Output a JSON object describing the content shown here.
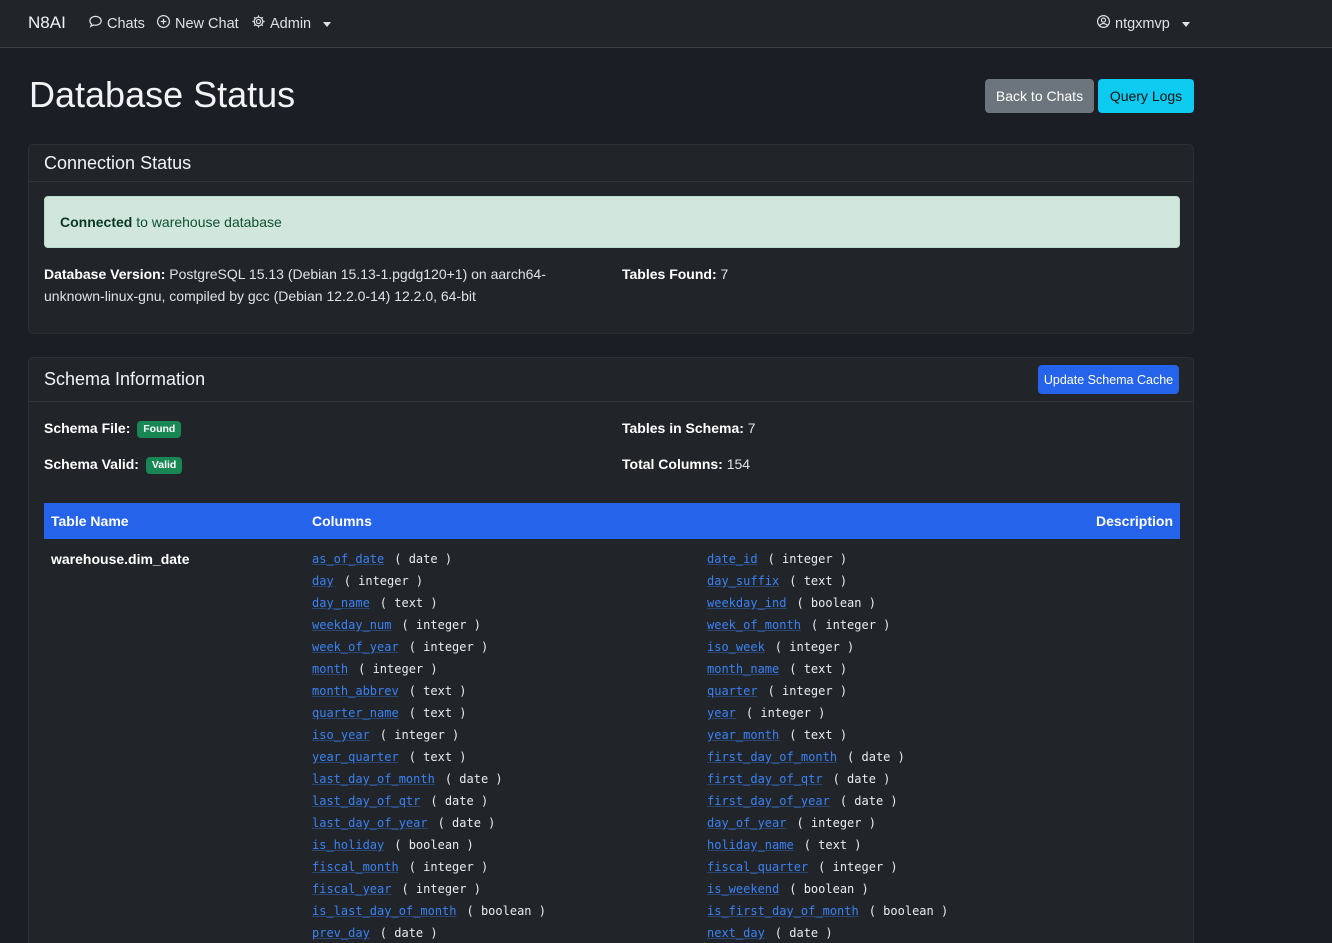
{
  "nav": {
    "brand": "N8AI",
    "chats": "Chats",
    "new_chat": "New Chat",
    "admin": "Admin",
    "user": "ntgxmvp"
  },
  "page": {
    "title": "Database Status",
    "back_button": "Back to Chats",
    "logs_button": "Query Logs"
  },
  "connection": {
    "title": "Connection Status",
    "alert_strong": "Connected",
    "alert_text": " to warehouse database",
    "version_label": "Database Version:",
    "version_value": " PostgreSQL 15.13 (Debian 15.13-1.pgdg120+1) on aarch64-unknown-linux-gnu, compiled by gcc (Debian 12.2.0-14) 12.2.0, 64-bit",
    "tables_label": "Tables Found:",
    "tables_value": " 7"
  },
  "schema": {
    "title": "Schema Information",
    "update_button": "Update Schema Cache",
    "file_label": "Schema File:",
    "file_badge": "Found",
    "valid_label": "Schema Valid:",
    "valid_badge": "Valid",
    "tables_label": "Tables in Schema:",
    "tables_value": " 7",
    "columns_label": "Total Columns:",
    "columns_value": " 154"
  },
  "table": {
    "headers": [
      "Table Name",
      "Columns",
      "Description"
    ],
    "rows": [
      {
        "name": "warehouse.dim_date",
        "left_columns": [
          {
            "name": "as_of_date",
            "type": "( date )"
          },
          {
            "name": "day",
            "type": "( integer )"
          },
          {
            "name": "day_name",
            "type": "( text )"
          },
          {
            "name": "weekday_num",
            "type": "( integer )"
          },
          {
            "name": "week_of_year",
            "type": "( integer )"
          },
          {
            "name": "month",
            "type": "( integer )"
          },
          {
            "name": "month_abbrev",
            "type": "( text )"
          },
          {
            "name": "quarter_name",
            "type": "( text )"
          },
          {
            "name": "iso_year",
            "type": "( integer )"
          },
          {
            "name": "year_quarter",
            "type": "( text )"
          },
          {
            "name": "last_day_of_month",
            "type": "( date )"
          },
          {
            "name": "last_day_of_qtr",
            "type": "( date )"
          },
          {
            "name": "last_day_of_year",
            "type": "( date )"
          },
          {
            "name": "is_holiday",
            "type": "( boolean )"
          },
          {
            "name": "fiscal_month",
            "type": "( integer )"
          },
          {
            "name": "fiscal_year",
            "type": "( integer )"
          },
          {
            "name": "is_last_day_of_month",
            "type": "( boolean )"
          },
          {
            "name": "prev_day",
            "type": "( date )"
          }
        ],
        "right_columns": [
          {
            "name": "date_id",
            "type": "( integer )"
          },
          {
            "name": "day_suffix",
            "type": "( text )"
          },
          {
            "name": "weekday_ind",
            "type": "( boolean )"
          },
          {
            "name": "week_of_month",
            "type": "( integer )"
          },
          {
            "name": "iso_week",
            "type": "( integer )"
          },
          {
            "name": "month_name",
            "type": "( text )"
          },
          {
            "name": "quarter",
            "type": "( integer )"
          },
          {
            "name": "year",
            "type": "( integer )"
          },
          {
            "name": "year_month",
            "type": "( text )"
          },
          {
            "name": "first_day_of_month",
            "type": "( date )"
          },
          {
            "name": "first_day_of_qtr",
            "type": "( date )"
          },
          {
            "name": "first_day_of_year",
            "type": "( date )"
          },
          {
            "name": "day_of_year",
            "type": "( integer )"
          },
          {
            "name": "holiday_name",
            "type": "( text )"
          },
          {
            "name": "fiscal_quarter",
            "type": "( integer )"
          },
          {
            "name": "is_weekend",
            "type": "( boolean )"
          },
          {
            "name": "is_first_day_of_month",
            "type": "( boolean )"
          },
          {
            "name": "next_day",
            "type": "( date )"
          }
        ]
      }
    ]
  }
}
